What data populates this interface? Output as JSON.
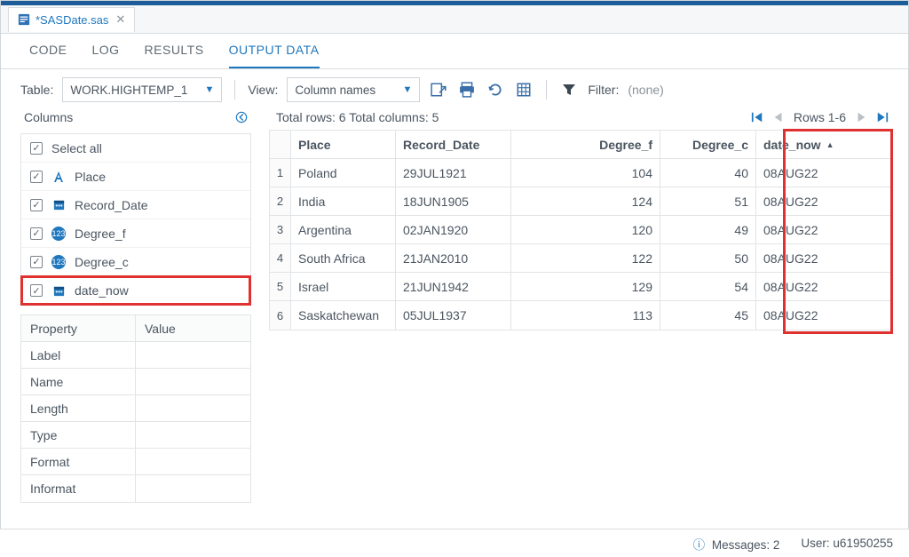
{
  "file_tab": {
    "label": "*SASDate.sas"
  },
  "subtabs": {
    "code": "CODE",
    "log": "LOG",
    "results": "RESULTS",
    "output": "OUTPUT DATA"
  },
  "toolbar": {
    "table_label": "Table:",
    "table_value": "WORK.HIGHTEMP_1",
    "view_label": "View:",
    "view_value": "Column names",
    "filter_label": "Filter:",
    "filter_value": "(none)"
  },
  "columns": {
    "header": "Columns",
    "items": [
      {
        "label": "Select all",
        "icon": "none"
      },
      {
        "label": "Place",
        "icon": "alpha"
      },
      {
        "label": "Record_Date",
        "icon": "calendar"
      },
      {
        "label": "Degree_f",
        "icon": "numeric"
      },
      {
        "label": "Degree_c",
        "icon": "numeric"
      },
      {
        "label": "date_now",
        "icon": "calendar"
      }
    ]
  },
  "properties": {
    "header_prop": "Property",
    "header_val": "Value",
    "rows": [
      "Label",
      "Name",
      "Length",
      "Type",
      "Format",
      "Informat"
    ]
  },
  "grid": {
    "summary": "Total rows: 6  Total columns: 5",
    "rows_range": "Rows 1-6",
    "headers": {
      "place": "Place",
      "record_date": "Record_Date",
      "degree_f": "Degree_f",
      "degree_c": "Degree_c",
      "date_now": "date_now"
    },
    "rows": [
      {
        "n": "1",
        "place": "Poland",
        "rdate": "29JUL1921",
        "f": "104",
        "c": "40",
        "dn": "08AUG22"
      },
      {
        "n": "2",
        "place": "India",
        "rdate": "18JUN1905",
        "f": "124",
        "c": "51",
        "dn": "08AUG22"
      },
      {
        "n": "3",
        "place": "Argentina",
        "rdate": "02JAN1920",
        "f": "120",
        "c": "49",
        "dn": "08AUG22"
      },
      {
        "n": "4",
        "place": "South Africa",
        "rdate": "21JAN2010",
        "f": "122",
        "c": "50",
        "dn": "08AUG22"
      },
      {
        "n": "5",
        "place": "Israel",
        "rdate": "21JUN1942",
        "f": "129",
        "c": "54",
        "dn": "08AUG22"
      },
      {
        "n": "6",
        "place": "Saskatchewan",
        "rdate": "05JUL1937",
        "f": "113",
        "c": "45",
        "dn": "08AUG22"
      }
    ]
  },
  "status": {
    "messages": "Messages: 2",
    "user_label": "User:",
    "user": "u61950255"
  }
}
